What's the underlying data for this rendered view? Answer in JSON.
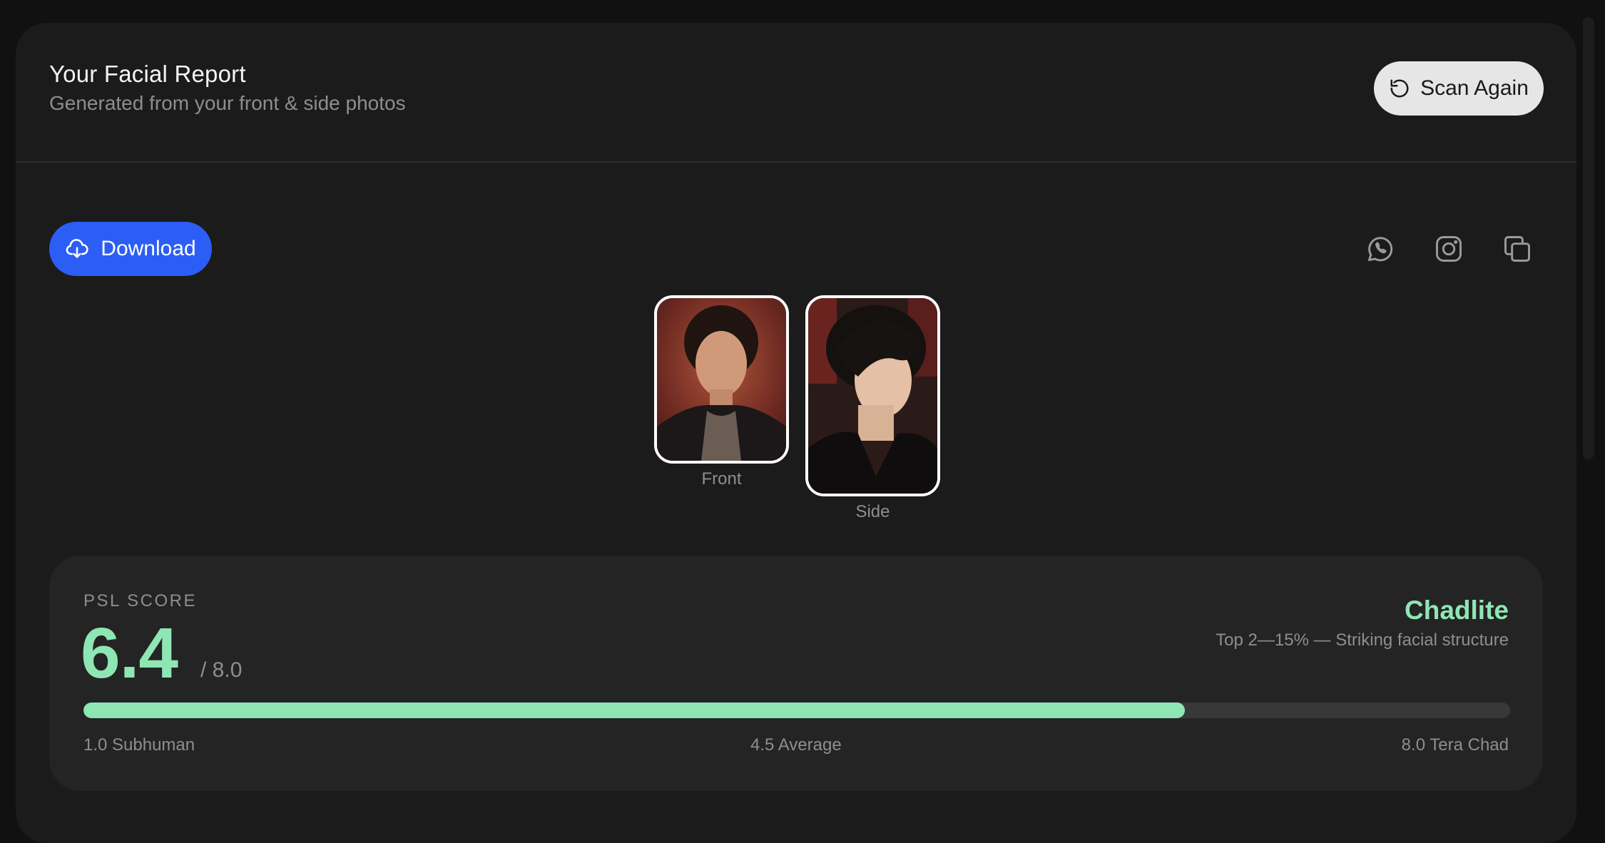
{
  "header": {
    "title": "Your Facial Report",
    "subtitle": "Generated from your front & side photos",
    "scan_again_label": "Scan Again"
  },
  "toolbar": {
    "download_label": "Download",
    "share_icons": [
      "whatsapp-icon",
      "instagram-icon",
      "copy-icon"
    ]
  },
  "photos": [
    {
      "label": "Front"
    },
    {
      "label": "Side"
    }
  ],
  "psl": {
    "label": "PSL SCORE",
    "score": "6.4",
    "max": "/ 8.0",
    "tier": "Chadlite",
    "tier_description": "Top 2—15% — Striking facial structure",
    "progress": 0.772,
    "scale_min": "1.0 Subhuman",
    "scale_mid": "4.5 Average",
    "scale_max": "8.0 Tera Chad"
  },
  "colors": {
    "accent_green": "#8ee6b4",
    "download_blue": "#2c5ef5",
    "card_bg": "#1b1b1b",
    "page_bg": "#111111"
  }
}
